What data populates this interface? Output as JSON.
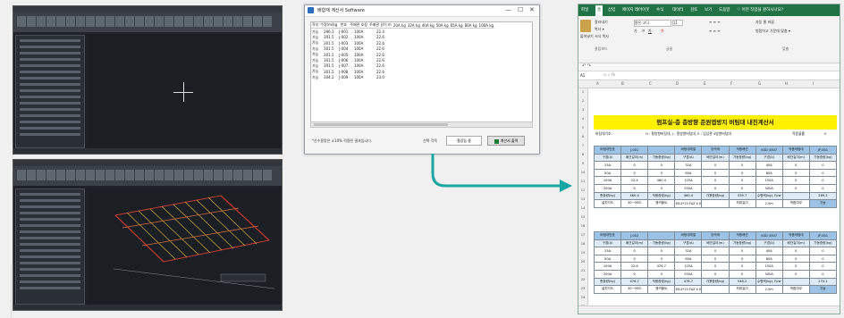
{
  "dialog": {
    "title": "배합재 계산서 Software",
    "controls": [
      "—",
      "☐",
      "✕"
    ],
    "columns": [
      "작부",
      "수량/m/kg",
      "번호",
      "주배관 호칭",
      "주배관 길이 m",
      "20A kg",
      "32A kg",
      "40A kg",
      "50A kg",
      "65A kg",
      "80A kg",
      "100A kg"
    ],
    "rows": [
      [
        "가능",
        "296.3",
        "J-001",
        "100A",
        "22.4"
      ],
      [
        "가능",
        "301.5",
        "J-002",
        "100A",
        "22.6"
      ],
      [
        "가능",
        "301.5",
        "J-003",
        "100A",
        "22.6"
      ],
      [
        "가능",
        "301.5",
        "J-004",
        "100A",
        "22.6"
      ],
      [
        "가능",
        "301.5",
        "J-005",
        "100A",
        "22.6"
      ],
      [
        "가능",
        "301.5",
        "J-006",
        "100A",
        "22.6"
      ],
      [
        "가능",
        "301.5",
        "J-007",
        "100A",
        "22.6"
      ],
      [
        "가능",
        "301.5",
        "J-008",
        "100A",
        "22.6"
      ],
      [
        "가능",
        "304.2",
        "J-009",
        "100A",
        "23.0"
      ]
    ],
    "note": "*산수용량은 ±10% 적용된 결과입니다.",
    "select_label": "선택 각목",
    "select_value": "철강능 중",
    "export_button": "계산서 출력"
  },
  "excel": {
    "tabs": [
      "파일",
      "홈",
      "삽입",
      "페이지 레이아웃",
      "수식",
      "데이터",
      "검토",
      "보기",
      "도움말",
      "♡ 어떤 작업을 원하시나요?"
    ],
    "active_tab": "홈",
    "ribbon": {
      "cut": "잘라내기",
      "copy": "복사 ▾",
      "format_painter": "서식 복사",
      "paste": "붙여넣기",
      "font": "맑은 고딕",
      "font_size": "11",
      "wrap": "자동 줄 바꿈",
      "merge": "병합하고 가운데 맞춤 ▾",
      "group_clipboard": "클립보드",
      "group_font": "글꼴",
      "group_align": "맞춤"
    },
    "name_box": "A1",
    "columns": [
      "A",
      "B",
      "C",
      "D",
      "E",
      "F",
      "G",
      "H",
      "I"
    ],
    "title": "펌프실-층 층방향 준원엽방지 버팀대 내진계산서",
    "info_left": "버팀대기호",
    "info_mid": "H : 횡방향버팀대, J : 종방향버팀대, E : 입상관 4방향버팀대",
    "info_right_label": "적용율률",
    "info_right_value": "0",
    "block1": {
      "header": [
        "버팀대번호",
        "J-001",
        "",
        "버팀대재질",
        "강속재",
        "적용배관",
        "KSD 3507",
        "적용버팀대",
        "JP-001"
      ],
      "sub": [
        "구경(A)",
        "배관길이(m)",
        "가동중량(kg)",
        "구경(A)",
        "배관길이(m)",
        "가동중량(kg)",
        "구경(A)",
        "배관길이(m)",
        "가동중량(kg)"
      ],
      "rows": [
        [
          "25A",
          "0",
          "0",
          "32A",
          "0",
          "0",
          "40A",
          "0",
          "0"
        ],
        [
          "50A",
          "0",
          "0",
          "65A",
          "0",
          "0",
          "80A",
          "0",
          "0"
        ],
        [
          "100A",
          "22.4",
          "460.4",
          "125A",
          "0",
          "0",
          "150A",
          "0",
          "0"
        ],
        [
          "200A",
          "0",
          "0",
          "250A",
          "0",
          "0",
          "300A",
          "0",
          "0"
        ]
      ],
      "total": [
        "총중량(kg)",
        "460.4",
        "적용중량(kg)",
        "460.4",
        "가용중량(kg)",
        "539.7",
        "수평력(kg), Fpw",
        "",
        "269.3"
      ],
      "install": [
        "설치각도",
        "30~90도",
        "앵커볼트",
        "M12*10 FAZ Ⅱ X",
        "",
        "최대길이",
        "2.5m",
        "적합여부",
        "가능"
      ]
    },
    "block2": {
      "header": [
        "버팀대번호",
        "J-002",
        "",
        "버팀대재질",
        "강속재",
        "적용배관",
        "KSD 3507",
        "적용버팀대",
        "JP-001"
      ],
      "sub": [
        "구경(A)",
        "배관길이(m)",
        "가동중량(kg)",
        "구경(A)",
        "배관길이(m)",
        "가동중량(kg)",
        "구경(A)",
        "배관길이(m)",
        "가동중량(kg)"
      ],
      "rows": [
        [
          "25A",
          "0",
          "0",
          "32A",
          "0",
          "0",
          "40A",
          "0",
          "0"
        ],
        [
          "50A",
          "0",
          "0",
          "65A",
          "0",
          "0",
          "80A",
          "0",
          "0"
        ],
        [
          "100A",
          "22.6",
          "476.7",
          "125A",
          "0",
          "0",
          "150A",
          "0",
          "0"
        ],
        [
          "200A",
          "0",
          "0",
          "250A",
          "0",
          "0",
          "300A",
          "0",
          "0"
        ]
      ],
      "total": [
        "총중량(kg)",
        "476.7",
        "적용중량(kg)",
        "476.7",
        "가용중량(kg)",
        "548.2",
        "수평력(kg), Fpw",
        "",
        "274.1"
      ],
      "install": [
        "설치각도",
        "30~90도",
        "앵커볼트",
        "M12*10 FAZ Ⅱ X",
        "",
        "최대길이",
        "2.5m",
        "적합여부",
        "가능"
      ]
    },
    "row_numbers": [
      "1",
      "2",
      "3",
      "4",
      "5",
      "6",
      "7",
      "8",
      "9",
      "10",
      "11",
      "12",
      "13",
      "14",
      "15",
      "16",
      "17",
      "18",
      "19",
      "20",
      "21",
      "22",
      "23",
      "24",
      "25"
    ]
  },
  "colors": {
    "excel_green": "#217346",
    "title_yellow": "#fff100",
    "header_blue": "#9cc3e6",
    "sub_blue": "#deebf7",
    "arrow_teal": "#1aa7a1",
    "cad_bg": "#1e2228"
  }
}
